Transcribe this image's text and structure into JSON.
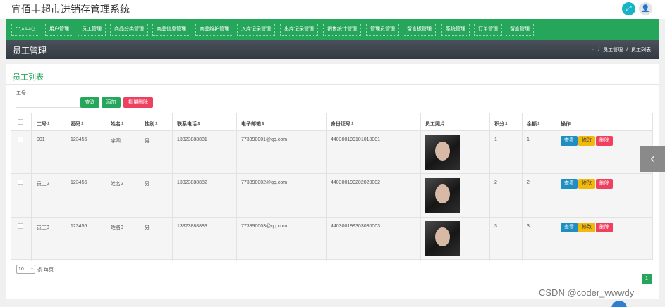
{
  "app": {
    "title": "宜佰丰超市进销存管理系统"
  },
  "topbar": {
    "expand_icon": "expand-icon",
    "user_icon": "user-icon"
  },
  "nav": {
    "items": [
      {
        "label": "个人中心"
      },
      {
        "label": "用户管理"
      },
      {
        "label": "员工管理"
      },
      {
        "label": "商品分类管理"
      },
      {
        "label": "商品信息管理"
      },
      {
        "label": "商品维护管理"
      },
      {
        "label": "入库记录管理"
      },
      {
        "label": "出库记录管理"
      },
      {
        "label": "销售统计管理"
      },
      {
        "label": "管理员管理"
      },
      {
        "label": "留言板管理"
      },
      {
        "label": "系统管理"
      },
      {
        "label": "订单管理"
      },
      {
        "label": "留言管理"
      }
    ]
  },
  "page": {
    "title": "员工管理",
    "breadcrumb": {
      "home_icon": "home-icon",
      "sep": "/",
      "level1": "员工管理",
      "level2": "员工列表"
    }
  },
  "panel": {
    "title": "员工列表",
    "search": {
      "label": "工号",
      "placeholder": "",
      "value": ""
    },
    "buttons": {
      "search": "查询",
      "add": "添加",
      "bulk_delete": "批量删除"
    }
  },
  "table": {
    "headers": {
      "id": "工号",
      "password": "密码",
      "name": "姓名",
      "gender": "性别",
      "phone": "联系电话",
      "email": "电子邮箱",
      "idcard": "身份证号",
      "photo": "员工照片",
      "points": "积分",
      "balance": "余额",
      "actions": "操作"
    },
    "rows": [
      {
        "id": "001",
        "password": "123456",
        "name": "李四",
        "gender": "男",
        "phone": "13823888881",
        "email": "773890001@qq.com",
        "idcard": "440300199101010001",
        "points": "1",
        "balance": "1"
      },
      {
        "id": "员工2",
        "password": "123456",
        "name": "姓名2",
        "gender": "男",
        "phone": "13823888882",
        "email": "773890002@qq.com",
        "idcard": "440300199202020002",
        "points": "2",
        "balance": "2"
      },
      {
        "id": "员工3",
        "password": "123456",
        "name": "姓名3",
        "gender": "男",
        "phone": "13823888883",
        "email": "773890003@qq.com",
        "idcard": "440300199303030003",
        "points": "3",
        "balance": "3"
      }
    ],
    "row_actions": {
      "view": "查看",
      "edit": "修改",
      "delete": "删除"
    }
  },
  "pagination": {
    "page_size": "10",
    "per_page_label": "条 每页",
    "current_page": "1"
  },
  "watermark": "CSDN @coder_wwwdy",
  "colors": {
    "primary_green": "#26a65b",
    "danger": "#ef4060",
    "info": "#1f8ec1",
    "warning": "#f2b90c"
  }
}
